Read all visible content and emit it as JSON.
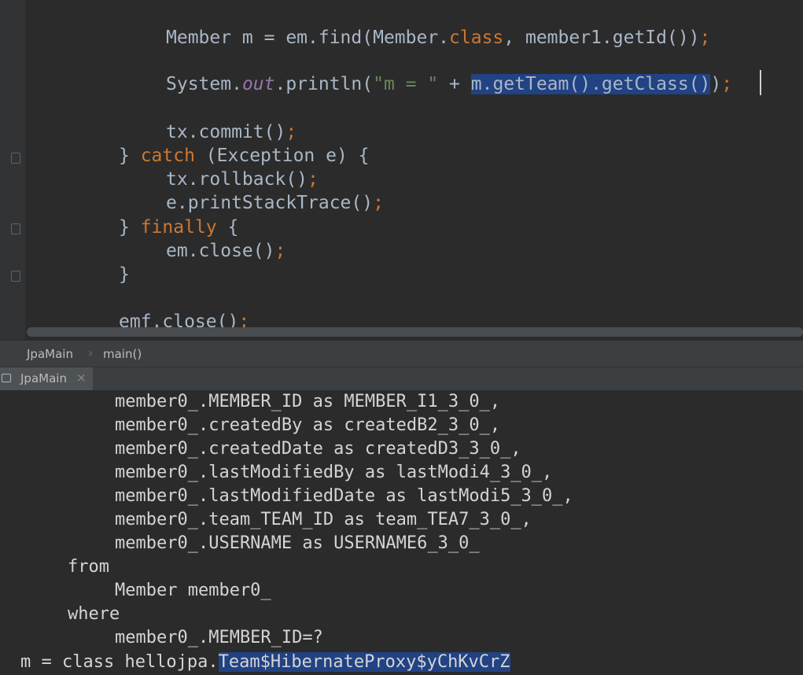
{
  "editor": {
    "lines": [
      {
        "parts": [
          "Member m = em.find(Member.",
          "class",
          ", member1.getId())",
          ";"
        ]
      },
      {
        "parts": [
          "System.",
          "out",
          ".println(",
          "\"m = \"",
          " + ",
          "m.getTeam().getClass()",
          ")",
          ";"
        ]
      },
      {
        "parts": [
          "tx.commit()",
          ";"
        ]
      },
      {
        "parts": [
          "} ",
          "catch",
          " (Exception e) {"
        ]
      },
      {
        "parts": [
          "tx.rollback()",
          ";"
        ]
      },
      {
        "parts": [
          "e.printStackTrace()",
          ";"
        ]
      },
      {
        "parts": [
          "} ",
          "finally",
          " {"
        ]
      },
      {
        "parts": [
          "em.close()",
          ";"
        ]
      },
      {
        "parts": [
          "}"
        ]
      },
      {
        "parts": [
          "emf.close()",
          ";"
        ]
      }
    ],
    "colors": {
      "background": "#2b2b2b",
      "keyword": "#cc7832",
      "static_field": "#9876aa",
      "string": "#6a8759",
      "selection": "#214283",
      "default_text": "#a9b7c6"
    }
  },
  "breadcrumb": {
    "items": [
      "JpaMain",
      "main()"
    ],
    "separator": "›"
  },
  "run_panel": {
    "tab_label": "JpaMain",
    "tab_icon": "console-icon",
    "close_glyph": "×"
  },
  "console": {
    "lines": [
      "member0_.MEMBER_ID as MEMBER_I1_3_0_,",
      "member0_.createdBy as createdB2_3_0_,",
      "member0_.createdDate as createdD3_3_0_,",
      "member0_.lastModifiedBy as lastModi4_3_0_,",
      "member0_.lastModifiedDate as lastModi5_3_0_,",
      "member0_.team_TEAM_ID as team_TEA7_3_0_,",
      "member0_.USERNAME as USERNAME6_3_0_",
      "from",
      "Member member0_",
      "where",
      "member0_.MEMBER_ID=?"
    ],
    "result_prefix": "m = class hellojpa.",
    "result_selected": "Team$HibernateProxy$yChKvCrZ"
  }
}
